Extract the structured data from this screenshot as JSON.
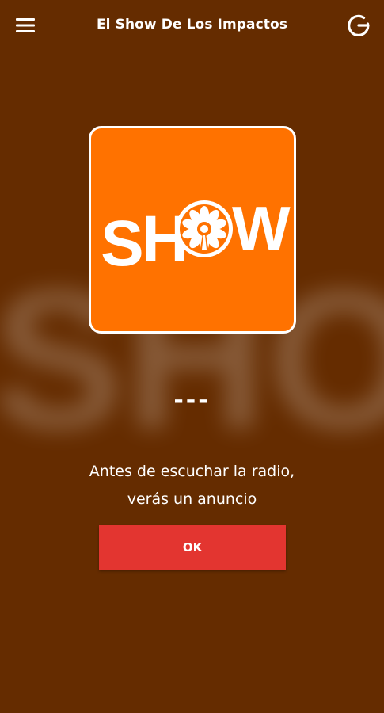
{
  "header": {
    "title": "El Show De Los Impactos",
    "menu_icon": "hamburger-menu-icon",
    "power_icon": "power-icon"
  },
  "logo": {
    "text": "SHOW",
    "background": "#ff7200"
  },
  "now_playing": {
    "track": "---"
  },
  "notice": {
    "line1": "Antes de escuchar la radio,",
    "line2": "verás un anuncio"
  },
  "ok_button": {
    "label": "OK",
    "color": "#e33530"
  },
  "colors": {
    "background": "#652c00",
    "text": "#ffffff"
  }
}
